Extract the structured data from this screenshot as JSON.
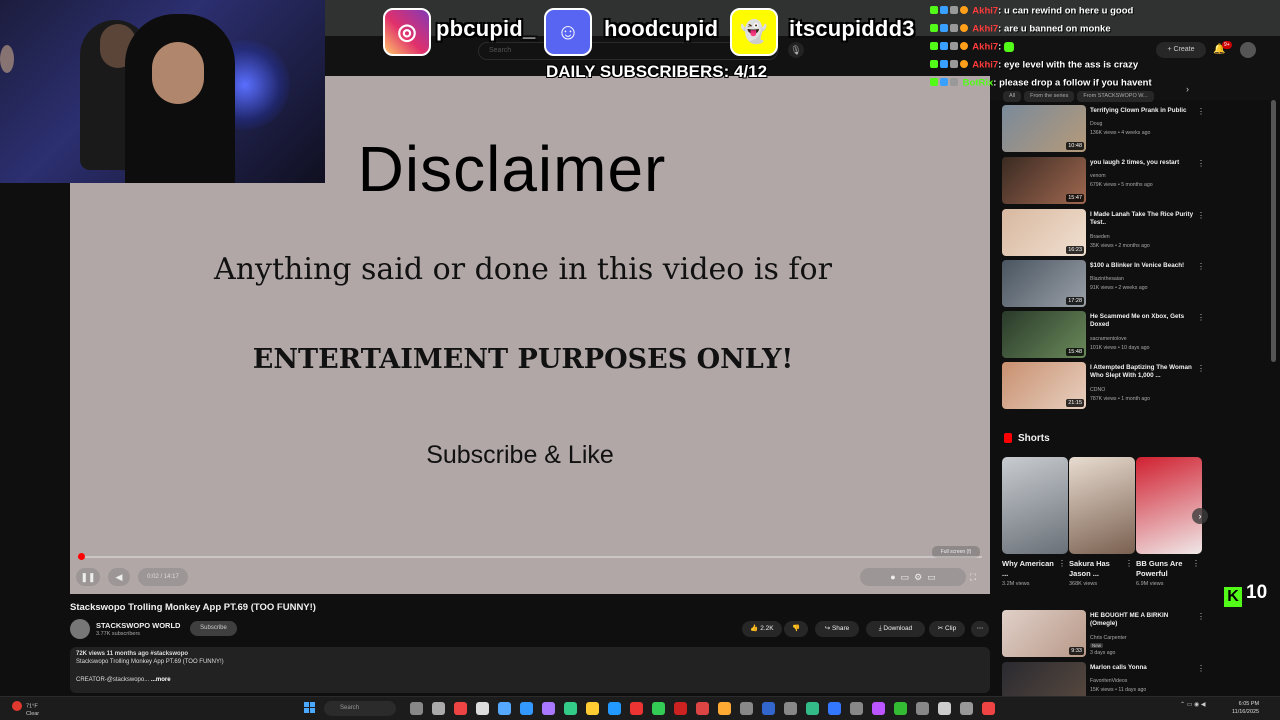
{
  "socials": {
    "instagram": "pbcupid_",
    "discord": "hoodcupid",
    "snapchat": "itscupiddd3",
    "daily_subscribers": "DAILY SUBSCRIBERS: 4/12"
  },
  "chat": [
    {
      "user": "Akhi7",
      "sep": ": ",
      "message": "u can rewind on here u good"
    },
    {
      "user": "Akhi7",
      "sep": ": ",
      "message": "are u banned on monke"
    },
    {
      "user": "Akhi7",
      "sep": ": ",
      "message": ""
    },
    {
      "user": "Akhi7",
      "sep": ": ",
      "message": "eye level with the ass is crazy"
    },
    {
      "user": "BotRix",
      "sep": ": ",
      "message": "please drop a follow if you havent"
    }
  ],
  "youtube_header": {
    "search_placeholder": "Search",
    "create_label": "+ Create",
    "notifications_count": "9+"
  },
  "video_content": {
    "title": "Disclaimer",
    "line1": "Anything said or done in this video is for",
    "line2": "ENTERTAIMENT PURPOSES ONLY!",
    "line3": "Subscribe & Like"
  },
  "player": {
    "time": "0:02 / 14:17",
    "progress_fraction": 0.002,
    "fullscreen_hint": "Full screen (f)"
  },
  "video_info": {
    "title": "Stackswopo Trolling Monkey App PT.69 (TOO FUNNY!)",
    "channel": "STACKSWOPO WORLD",
    "subscribers": "3.77K subscribers",
    "subscribe_label": "Subscribe",
    "likes": "2.2K",
    "share_label": "Share",
    "download_label": "Download",
    "clip_label": "Clip",
    "meta": "72K views  11 months ago  #stackswopo",
    "description": "Stackswopo Trolling Monkey App PT.69 (TOO FUNNY!)",
    "creator": "CREATOR-@stackswopo...",
    "more": "...more"
  },
  "chips": [
    "All",
    "From the series",
    "From STACKSWOPO W..."
  ],
  "recommendations": [
    {
      "title": "Terrifying Clown Prank in Public",
      "channel": "Doug",
      "meta": "136K views • 4 weeks ago",
      "duration": "10:48",
      "colors": [
        "#7a8a9a",
        "#b59a7a"
      ]
    },
    {
      "title": "you laugh 2 times, you restart",
      "channel": "venom",
      "meta": "679K views • 5 months ago",
      "duration": "15:47",
      "colors": [
        "#3a2a22",
        "#a06850"
      ]
    },
    {
      "title": "I Made Lanah Take The Rice Purity Test..",
      "channel": "Braeden",
      "meta": "35K views • 2 months ago",
      "duration": "16:23",
      "colors": [
        "#d8b8a0",
        "#f0e0d0"
      ]
    },
    {
      "title": "$100 a Blinker In Venice Beach!",
      "channel": "Blazinthesaian",
      "meta": "91K views • 2 weeks ago",
      "duration": "17:28",
      "colors": [
        "#4a5560",
        "#9aa0a8"
      ]
    },
    {
      "title": "He Scammed Me on Xbox, Gets Doxed",
      "channel": "sacramentolove",
      "meta": "101K views • 10 days ago",
      "duration": "15:48",
      "colors": [
        "#2a3a2a",
        "#6a8a5a"
      ]
    },
    {
      "title": "I Attempted Baptizing The Woman Who Slept With 1,000 ...",
      "channel": "CDNO",
      "meta": "787K views • 1 month ago",
      "duration": "21:15",
      "colors": [
        "#c89070",
        "#e8d0c0"
      ]
    },
    {
      "title": "HE BOUGHT ME A BIRKIN (Omegle)",
      "channel": "Chris Carpenter",
      "meta": "3 days ago",
      "duration": "9:33",
      "badge": "New",
      "colors": [
        "#e0d0c8",
        "#b89888"
      ]
    },
    {
      "title": "Marlon calls Yonna",
      "channel": "FavoritenVideos",
      "meta": "15K views • 11 days ago",
      "duration": "",
      "colors": [
        "#2a2a30",
        "#5a4a40"
      ]
    }
  ],
  "shorts": {
    "header": "Shorts",
    "items": [
      {
        "title": "Why American ...",
        "views": "3.2M views",
        "colors": [
          "#c8ccd0",
          "#6a7078"
        ]
      },
      {
        "title": "Sakura Has Jason ...",
        "views": "368K views",
        "colors": [
          "#e8dcd0",
          "#7a6050"
        ]
      },
      {
        "title": "BB Guns Are Powerful",
        "views": "6.9M views",
        "colors": [
          "#d02030",
          "#f0e8e8"
        ]
      }
    ]
  },
  "kick_viewers": "10",
  "taskbar": {
    "weather_temp": "71°F",
    "weather_desc": "Clear",
    "search": "Search",
    "time": "6:05 PM",
    "date": "11/16/2025"
  }
}
